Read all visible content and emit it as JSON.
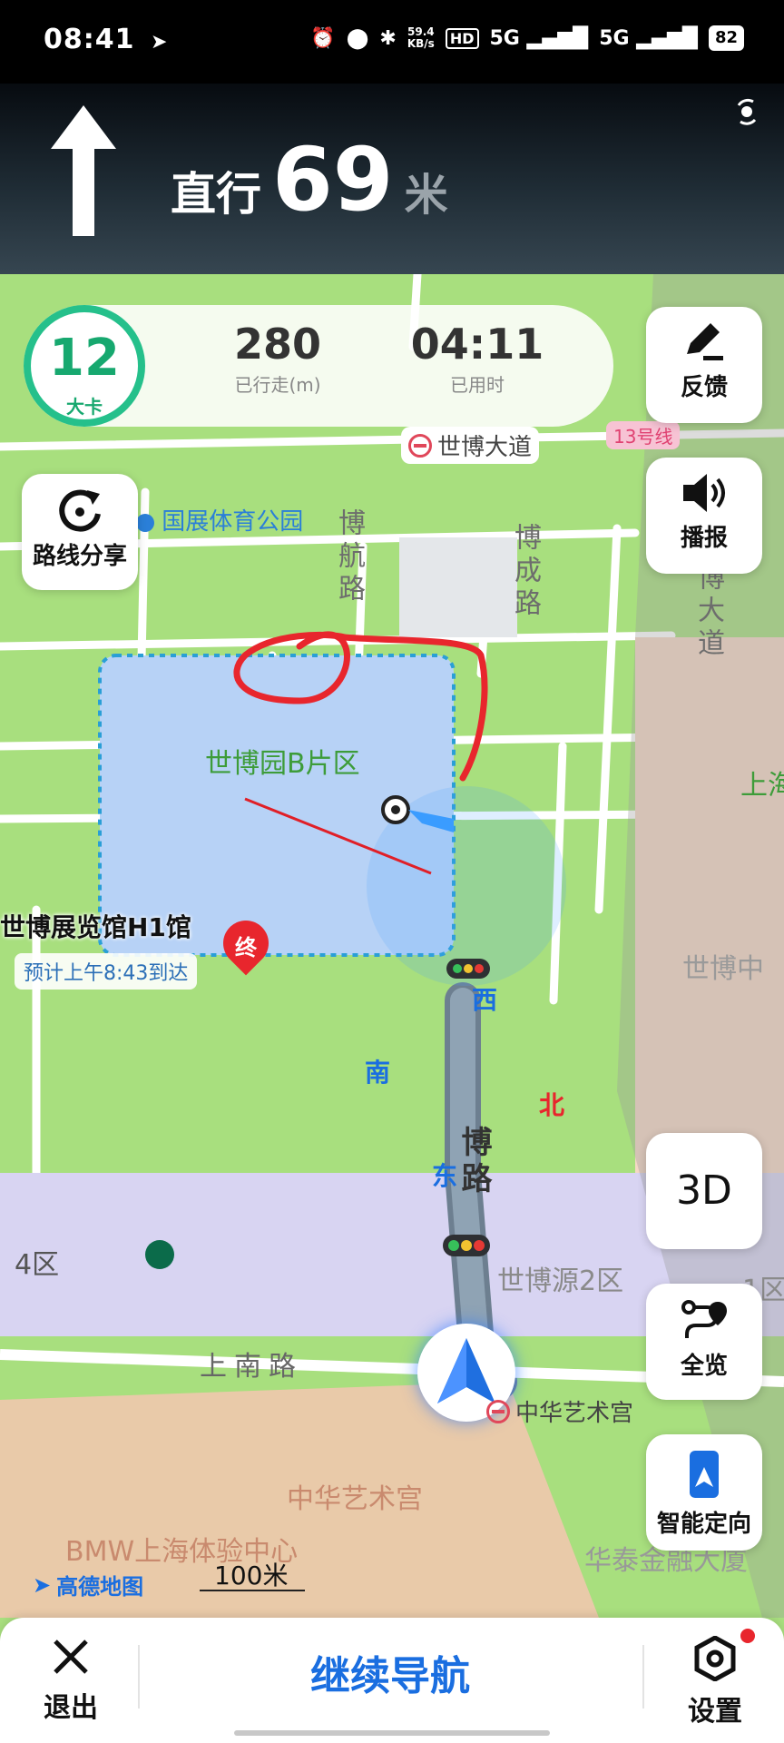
{
  "status_bar": {
    "time": "08:41",
    "net_speed_value": "59.4",
    "net_speed_unit": "KB/s",
    "hd_label": "HD",
    "signal1": "5G",
    "signal2": "5G",
    "battery": "82"
  },
  "nav": {
    "action": "直行",
    "distance": "69",
    "unit": "米"
  },
  "stats": {
    "speed": "12",
    "speed_unit": "大卡",
    "distance_value": "280",
    "distance_label": "已行走(m)",
    "time_value": "04:11",
    "time_label": "已用时"
  },
  "side_buttons": {
    "feedback": "反馈",
    "broadcast": "播报",
    "share_route": "路线分享",
    "mode_3d": "3D",
    "overview": "全览",
    "smart_locate": "智能定向"
  },
  "map": {
    "road_label_top": "世博大道",
    "metro_line": "13号线",
    "park": "国展体育公园",
    "bohang_road": "博航路",
    "bocheng_road": "博成路",
    "bo_avenue": "博大道",
    "expo_b_zone": "世博园B片区",
    "shang_right": "上海",
    "expo_center": "世博中",
    "dest_name": "世博展览馆H1馆",
    "eta": "预计上午8:43到达",
    "dest_marker": "终",
    "compass_west": "西",
    "compass_south": "南",
    "compass_north": "北",
    "compass_east": "东",
    "bodong_road": "博路",
    "zone4": "4区",
    "expo_source2": "世博源2区",
    "zone1": "1区",
    "shangnan_road": "上南路",
    "china_art_station": "中华艺术宫",
    "china_art": "中华艺术宫",
    "bmw": "BMW上海体验中心",
    "huatai": "华泰金融大厦",
    "amap": "高德地图",
    "scale": "100米"
  },
  "bottom": {
    "exit": "退出",
    "continue": "继续导航",
    "settings": "设置"
  },
  "colors": {
    "accent_green": "#25c08b",
    "route_blue": "#1a6ee0",
    "annotation_red": "#e8262d"
  }
}
